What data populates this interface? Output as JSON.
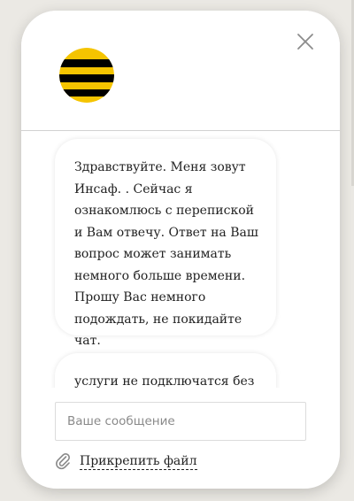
{
  "brand": {
    "logo_icon": "beeline-logo-icon",
    "colors": {
      "logo_yellow": "#f5c400",
      "logo_black": "#000000",
      "accent_border": "#d2d2d2"
    }
  },
  "header": {
    "close_icon": "close-icon"
  },
  "messages": [
    {
      "text": "Здравствуйте. Меня зовут Инсаф. . Сейчас я ознакомлюсь с перепиской и Вам отвечу. Ответ на Ваш вопрос может занимать немного больше времени. Прошу Вас немного подождать, не покидайте чат."
    },
    {
      "text": "услуги не подключатся без"
    }
  ],
  "composer": {
    "placeholder": "Ваше сообщение",
    "value": ""
  },
  "attach": {
    "icon": "paperclip-icon",
    "label": "Прикрепить файл"
  }
}
